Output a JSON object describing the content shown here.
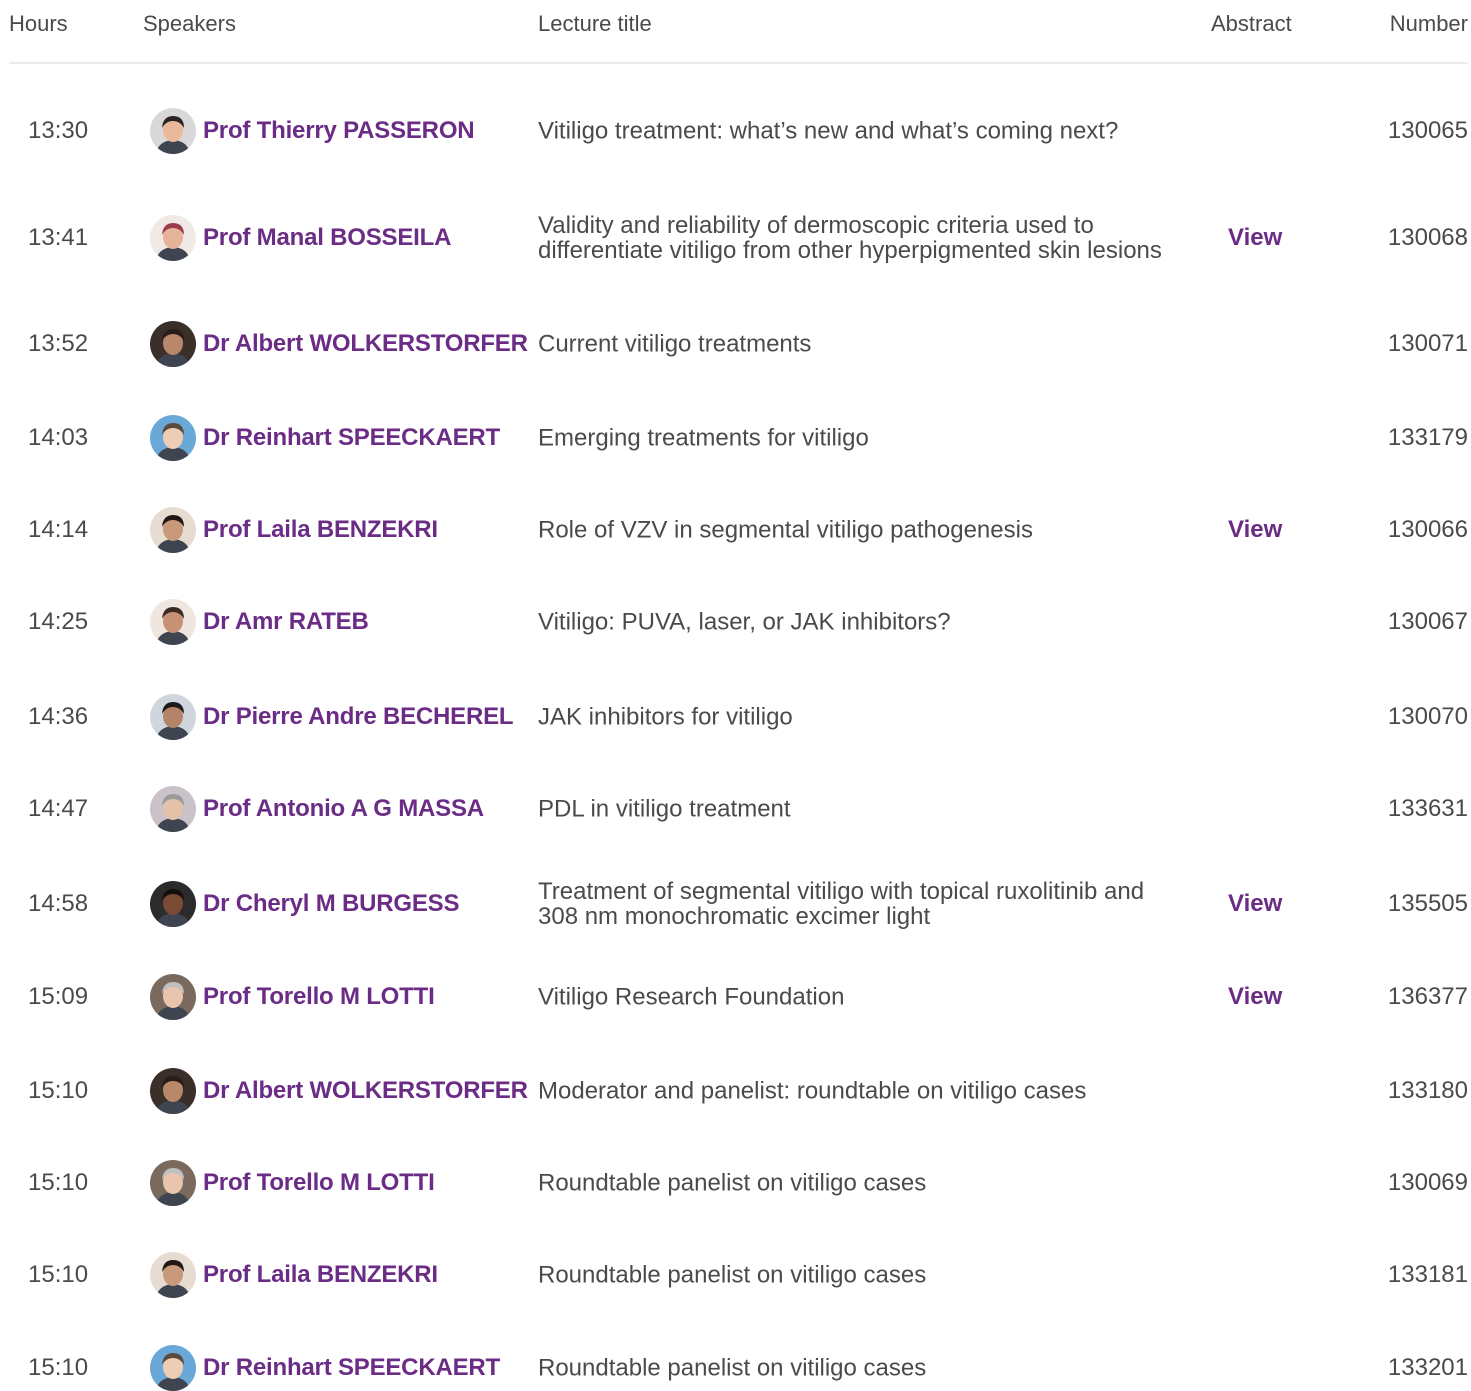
{
  "header": {
    "hours": "Hours",
    "speakers": "Speakers",
    "lecture_title": "Lecture title",
    "abstract": "Abstract",
    "number": "Number"
  },
  "colors": {
    "accent": "#6b2c86",
    "text": "#4a4a4a",
    "rule": "#ebebeb"
  },
  "rows": [
    {
      "hour": "13:30",
      "speaker": "Prof Thierry PASSERON",
      "title": "Vitiligo treatment: what’s new and what’s coming next?",
      "abstract": "",
      "number": "130065",
      "avatar": "speaker-photo-icon"
    },
    {
      "hour": "13:41",
      "speaker": "Prof Manal BOSSEILA",
      "title": "Validity and reliability of dermoscopic criteria used to differentiate vitiligo from other hyperpigmented skin lesions",
      "abstract": "View",
      "number": "130068",
      "avatar": "speaker-photo-icon"
    },
    {
      "hour": "13:52",
      "speaker": "Dr Albert WOLKERSTORFER",
      "title": "Current vitiligo treatments",
      "abstract": "",
      "number": "130071",
      "avatar": "speaker-photo-icon"
    },
    {
      "hour": "14:03",
      "speaker": "Dr Reinhart SPEECKAERT",
      "title": "Emerging treatments for vitiligo",
      "abstract": "",
      "number": "133179",
      "avatar": "speaker-photo-icon"
    },
    {
      "hour": "14:14",
      "speaker": "Prof Laila BENZEKRI",
      "title": "Role of VZV in segmental vitiligo pathogenesis",
      "abstract": "View",
      "number": "130066",
      "avatar": "speaker-photo-icon"
    },
    {
      "hour": "14:25",
      "speaker": "Dr Amr RATEB",
      "title": "Vitiligo: PUVA, laser, or JAK inhibitors?",
      "abstract": "",
      "number": "130067",
      "avatar": "speaker-photo-icon"
    },
    {
      "hour": "14:36",
      "speaker": "Dr Pierre Andre BECHEREL",
      "title": "JAK inhibitors for vitiligo",
      "abstract": "",
      "number": "130070",
      "avatar": "speaker-photo-icon"
    },
    {
      "hour": "14:47",
      "speaker": "Prof Antonio A G MASSA",
      "title": "PDL in vitiligo treatment",
      "abstract": "",
      "number": "133631",
      "avatar": "speaker-photo-icon"
    },
    {
      "hour": "14:58",
      "speaker": "Dr Cheryl M BURGESS",
      "title": "Treatment of segmental vitiligo with topical ruxolitinib and 308 nm monochromatic excimer light",
      "abstract": "View",
      "number": "135505",
      "avatar": "speaker-photo-icon"
    },
    {
      "hour": "15:09",
      "speaker": "Prof Torello M LOTTI",
      "title": "Vitiligo Research Foundation",
      "abstract": "View",
      "number": "136377",
      "avatar": "speaker-photo-icon"
    },
    {
      "hour": "15:10",
      "speaker": "Dr Albert WOLKERSTORFER",
      "title": "Moderator and panelist: roundtable on vitiligo cases",
      "abstract": "",
      "number": "133180",
      "avatar": "speaker-photo-icon"
    },
    {
      "hour": "15:10",
      "speaker": "Prof Torello M LOTTI",
      "title": "Roundtable panelist on vitiligo cases",
      "abstract": "",
      "number": "130069",
      "avatar": "speaker-photo-icon"
    },
    {
      "hour": "15:10",
      "speaker": "Prof Laila BENZEKRI",
      "title": "Roundtable panelist on vitiligo cases",
      "abstract": "",
      "number": "133181",
      "avatar": "speaker-photo-icon"
    },
    {
      "hour": "15:10",
      "speaker": "Dr Reinhart SPEECKAERT",
      "title": "Roundtable panelist on vitiligo cases",
      "abstract": "",
      "number": "133201",
      "avatar": "speaker-photo-icon"
    }
  ]
}
